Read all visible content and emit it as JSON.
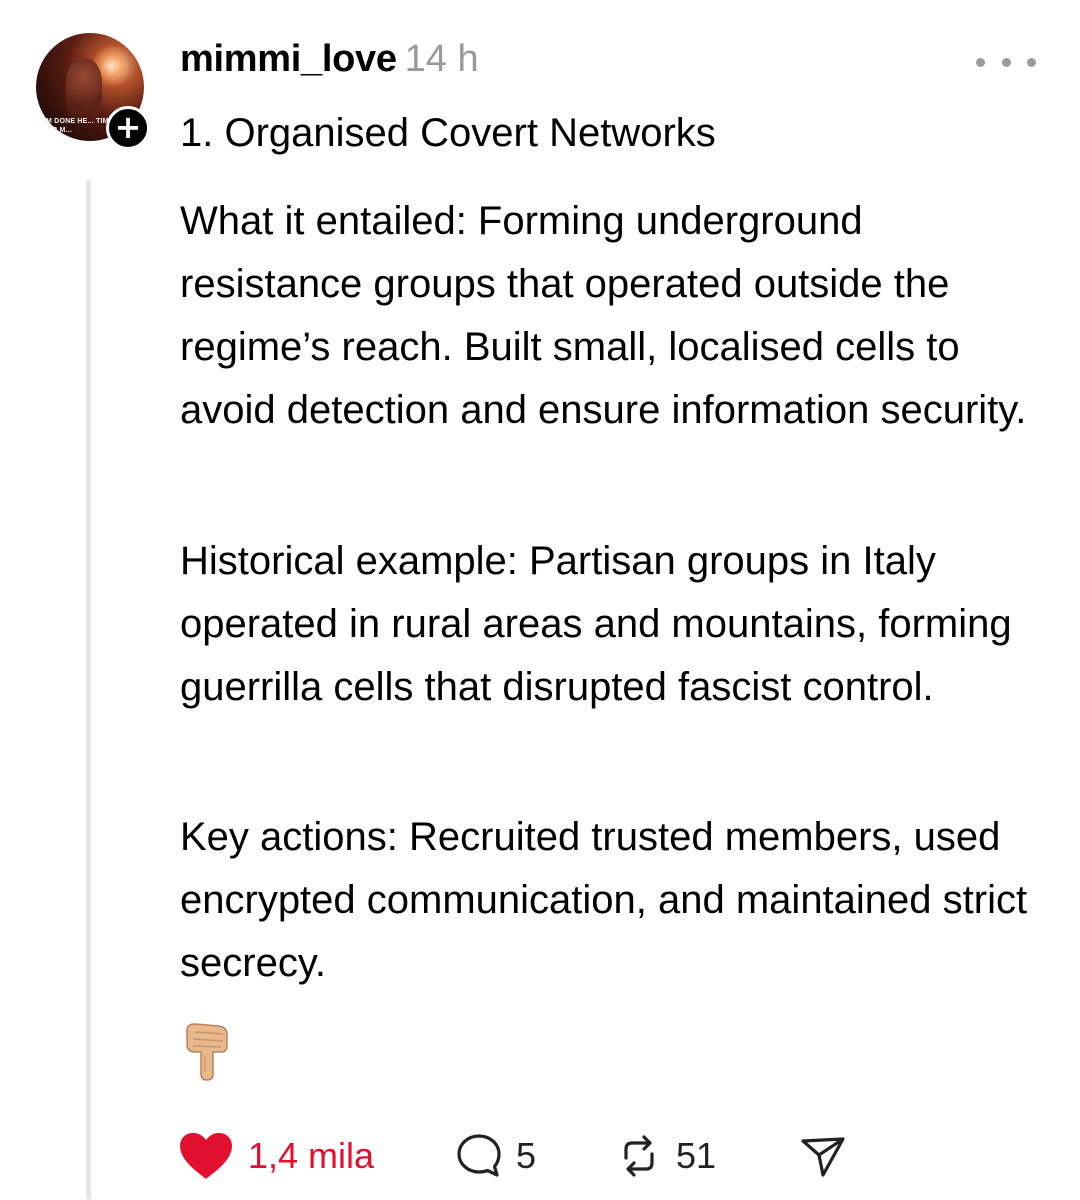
{
  "post": {
    "author": {
      "username": "mimmi_love",
      "avatar_caption": "I'M DONE HE... TIME FOR M..."
    },
    "timestamp": "14 h",
    "heading": "1. Organised Covert Networks",
    "paragraphs": [
      "What it entailed: Forming underground resistance groups that operated outside the regime’s reach. Built small, localised cells to avoid detection and ensure information security.",
      "Historical example: Partisan groups in Italy operated in rural areas and mountains, forming guerrilla cells that disrupted fascist control.",
      "Key actions: Recruited trusted members, used encrypted communication, and maintained strict secrecy."
    ],
    "trailing_emoji": "backhand-index-pointing-down"
  },
  "actions": {
    "like": {
      "count": "1,4 mila",
      "liked": true,
      "icon": "heart-icon"
    },
    "reply": {
      "count": "5",
      "icon": "comment-icon"
    },
    "repost": {
      "count": "51",
      "icon": "repost-icon"
    },
    "share": {
      "icon": "send-icon"
    }
  },
  "colors": {
    "like_red": "#e0102e",
    "muted_gray": "#9a9a9a",
    "thread_line": "#e6e6e6"
  }
}
